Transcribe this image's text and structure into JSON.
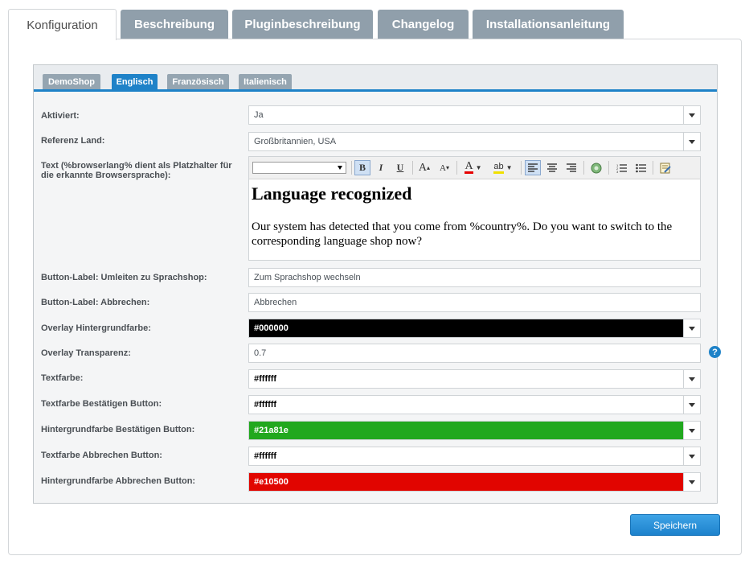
{
  "tabs": [
    "Konfiguration",
    "Beschreibung",
    "Pluginbeschreibung",
    "Changelog",
    "Installationsanleitung"
  ],
  "subtabs": [
    "DemoShop",
    "Englisch",
    "Französisch",
    "Italienisch"
  ],
  "active_tab": "Konfiguration",
  "active_subtab": "Englisch",
  "form": {
    "aktiviert": {
      "label": "Aktiviert:",
      "value": "Ja"
    },
    "referenz_land": {
      "label": "Referenz Land:",
      "value": "Großbritannien, USA"
    },
    "text": {
      "label": "Text (%browserlang% dient als Platzhalter für die erkannte Browsersprache):",
      "heading": "Language recognized",
      "body": "Our system has detected that you come from %country%. Do you want to switch to the corresponding language shop now?"
    },
    "button_umleiten": {
      "label": "Button-Label: Umleiten zu Sprachshop:",
      "value": "Zum Sprachshop wechseln"
    },
    "button_abbrechen": {
      "label": "Button-Label: Abbrechen:",
      "value": "Abbrechen"
    },
    "overlay_bg": {
      "label": "Overlay Hintergrundfarbe:",
      "value": "#000000"
    },
    "overlay_transparenz": {
      "label": "Overlay Transparenz:",
      "value": "0.7"
    },
    "textfarbe": {
      "label": "Textfarbe:",
      "value": "#ffffff"
    },
    "textfarbe_bestaetigen": {
      "label": "Textfarbe Bestätigen Button:",
      "value": "#ffffff"
    },
    "hintergrund_bestaetigen": {
      "label": "Hintergrundfarbe Bestätigen Button:",
      "value": "#21a81e"
    },
    "textfarbe_abbrechen": {
      "label": "Textfarbe Abbrechen Button:",
      "value": "#ffffff"
    },
    "hintergrund_abbrechen": {
      "label": "Hintergrundfarbe Abbrechen Button:",
      "value": "#e10500"
    }
  },
  "help_icon": "?",
  "toolbar_icons": [
    "font-select",
    "bold-icon",
    "italic-icon",
    "underline-icon",
    "increase-font-icon",
    "decrease-font-icon",
    "font-color-icon",
    "highlight-icon",
    "align-left-icon",
    "align-center-icon",
    "align-right-icon",
    "insert-image-icon",
    "ordered-list-icon",
    "unordered-list-icon",
    "edit-source-icon"
  ],
  "save_label": "Speichern",
  "colors": {
    "accent": "#1e82c8",
    "tab_inactive": "#909fab",
    "green": "#21a81e",
    "red": "#e10500",
    "black": "#000000"
  }
}
